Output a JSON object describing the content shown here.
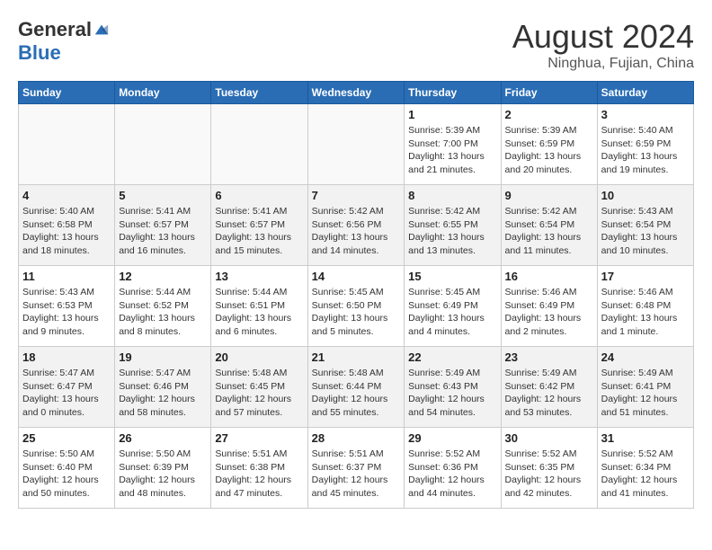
{
  "header": {
    "logo": {
      "general": "General",
      "blue": "Blue",
      "tagline": ""
    },
    "title": "August 2024",
    "location": "Ninghua, Fujian, China"
  },
  "weekdays": [
    "Sunday",
    "Monday",
    "Tuesday",
    "Wednesday",
    "Thursday",
    "Friday",
    "Saturday"
  ],
  "weeks": [
    [
      {
        "day": "",
        "empty": true
      },
      {
        "day": "",
        "empty": true
      },
      {
        "day": "",
        "empty": true
      },
      {
        "day": "",
        "empty": true
      },
      {
        "day": "1",
        "sunrise": "5:39 AM",
        "sunset": "7:00 PM",
        "daylight": "13 hours and 21 minutes."
      },
      {
        "day": "2",
        "sunrise": "5:39 AM",
        "sunset": "6:59 PM",
        "daylight": "13 hours and 20 minutes."
      },
      {
        "day": "3",
        "sunrise": "5:40 AM",
        "sunset": "6:59 PM",
        "daylight": "13 hours and 19 minutes."
      }
    ],
    [
      {
        "day": "4",
        "sunrise": "5:40 AM",
        "sunset": "6:58 PM",
        "daylight": "13 hours and 18 minutes."
      },
      {
        "day": "5",
        "sunrise": "5:41 AM",
        "sunset": "6:57 PM",
        "daylight": "13 hours and 16 minutes."
      },
      {
        "day": "6",
        "sunrise": "5:41 AM",
        "sunset": "6:57 PM",
        "daylight": "13 hours and 15 minutes."
      },
      {
        "day": "7",
        "sunrise": "5:42 AM",
        "sunset": "6:56 PM",
        "daylight": "13 hours and 14 minutes."
      },
      {
        "day": "8",
        "sunrise": "5:42 AM",
        "sunset": "6:55 PM",
        "daylight": "13 hours and 13 minutes."
      },
      {
        "day": "9",
        "sunrise": "5:42 AM",
        "sunset": "6:54 PM",
        "daylight": "13 hours and 11 minutes."
      },
      {
        "day": "10",
        "sunrise": "5:43 AM",
        "sunset": "6:54 PM",
        "daylight": "13 hours and 10 minutes."
      }
    ],
    [
      {
        "day": "11",
        "sunrise": "5:43 AM",
        "sunset": "6:53 PM",
        "daylight": "13 hours and 9 minutes."
      },
      {
        "day": "12",
        "sunrise": "5:44 AM",
        "sunset": "6:52 PM",
        "daylight": "13 hours and 8 minutes."
      },
      {
        "day": "13",
        "sunrise": "5:44 AM",
        "sunset": "6:51 PM",
        "daylight": "13 hours and 6 minutes."
      },
      {
        "day": "14",
        "sunrise": "5:45 AM",
        "sunset": "6:50 PM",
        "daylight": "13 hours and 5 minutes."
      },
      {
        "day": "15",
        "sunrise": "5:45 AM",
        "sunset": "6:49 PM",
        "daylight": "13 hours and 4 minutes."
      },
      {
        "day": "16",
        "sunrise": "5:46 AM",
        "sunset": "6:49 PM",
        "daylight": "13 hours and 2 minutes."
      },
      {
        "day": "17",
        "sunrise": "5:46 AM",
        "sunset": "6:48 PM",
        "daylight": "13 hours and 1 minute."
      }
    ],
    [
      {
        "day": "18",
        "sunrise": "5:47 AM",
        "sunset": "6:47 PM",
        "daylight": "13 hours and 0 minutes."
      },
      {
        "day": "19",
        "sunrise": "5:47 AM",
        "sunset": "6:46 PM",
        "daylight": "12 hours and 58 minutes."
      },
      {
        "day": "20",
        "sunrise": "5:48 AM",
        "sunset": "6:45 PM",
        "daylight": "12 hours and 57 minutes."
      },
      {
        "day": "21",
        "sunrise": "5:48 AM",
        "sunset": "6:44 PM",
        "daylight": "12 hours and 55 minutes."
      },
      {
        "day": "22",
        "sunrise": "5:49 AM",
        "sunset": "6:43 PM",
        "daylight": "12 hours and 54 minutes."
      },
      {
        "day": "23",
        "sunrise": "5:49 AM",
        "sunset": "6:42 PM",
        "daylight": "12 hours and 53 minutes."
      },
      {
        "day": "24",
        "sunrise": "5:49 AM",
        "sunset": "6:41 PM",
        "daylight": "12 hours and 51 minutes."
      }
    ],
    [
      {
        "day": "25",
        "sunrise": "5:50 AM",
        "sunset": "6:40 PM",
        "daylight": "12 hours and 50 minutes."
      },
      {
        "day": "26",
        "sunrise": "5:50 AM",
        "sunset": "6:39 PM",
        "daylight": "12 hours and 48 minutes."
      },
      {
        "day": "27",
        "sunrise": "5:51 AM",
        "sunset": "6:38 PM",
        "daylight": "12 hours and 47 minutes."
      },
      {
        "day": "28",
        "sunrise": "5:51 AM",
        "sunset": "6:37 PM",
        "daylight": "12 hours and 45 minutes."
      },
      {
        "day": "29",
        "sunrise": "5:52 AM",
        "sunset": "6:36 PM",
        "daylight": "12 hours and 44 minutes."
      },
      {
        "day": "30",
        "sunrise": "5:52 AM",
        "sunset": "6:35 PM",
        "daylight": "12 hours and 42 minutes."
      },
      {
        "day": "31",
        "sunrise": "5:52 AM",
        "sunset": "6:34 PM",
        "daylight": "12 hours and 41 minutes."
      }
    ]
  ],
  "labels": {
    "sunrise": "Sunrise:",
    "sunset": "Sunset:",
    "daylight": "Daylight:"
  }
}
